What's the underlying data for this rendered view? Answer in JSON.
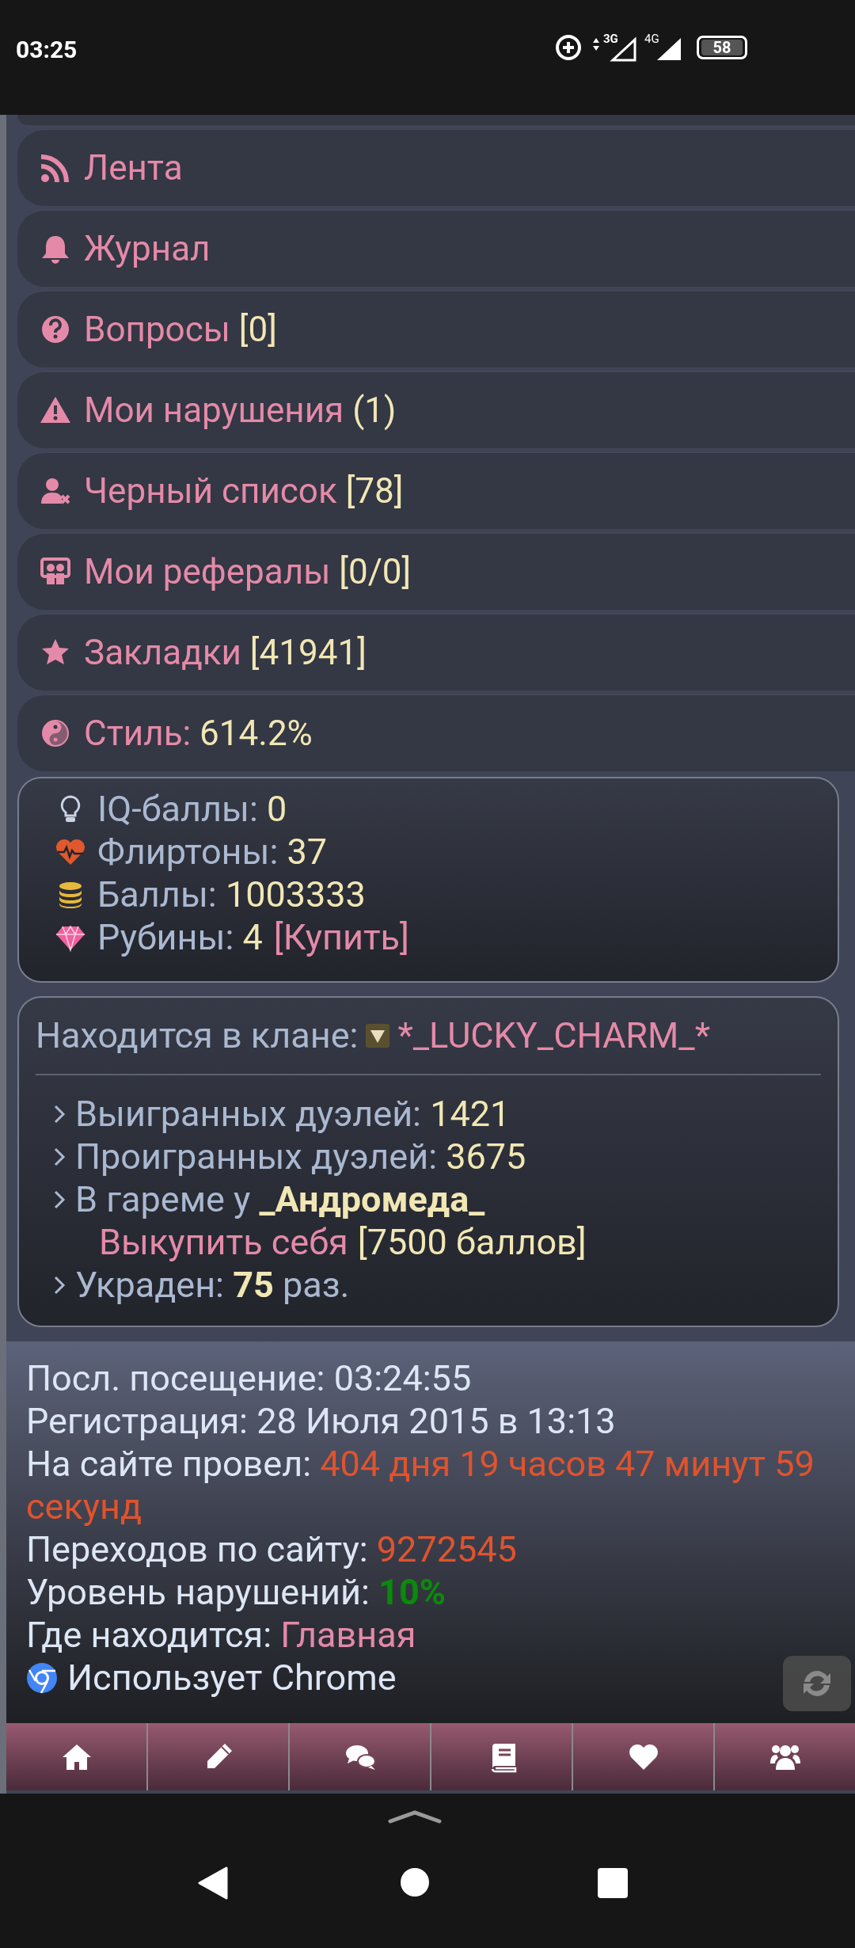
{
  "status_bar": {
    "time": "03:25",
    "network_1": "3G",
    "network_2": "4G",
    "battery": "58"
  },
  "menu": [
    {
      "label": "Лента"
    },
    {
      "label": "Журнал"
    },
    {
      "label": "Вопросы",
      "count": "[0]"
    },
    {
      "label": "Мои нарушения",
      "count": "(1)"
    },
    {
      "label": "Черный список",
      "count": "[78]"
    },
    {
      "label": "Мои рефералы",
      "count": "[0/0]"
    },
    {
      "label": "Закладки",
      "count": "[41941]"
    },
    {
      "label": "Стиль:",
      "count": "614.2%"
    }
  ],
  "wallet": [
    {
      "label": "IQ-баллы:",
      "value": "0"
    },
    {
      "label": "Флиртоны:",
      "value": "37"
    },
    {
      "label": "Баллы:",
      "value": "1003333"
    },
    {
      "label": "Рубины:",
      "value": "4",
      "link": "[Купить]"
    }
  ],
  "clan": {
    "label": "Находится в клане:",
    "name": "*_LUCKY_CHARM_*",
    "rows": [
      {
        "label": "Выигранных дуэлей:",
        "value": "1421"
      },
      {
        "label": "Проигранных дуэлей:",
        "value": "3675"
      },
      {
        "label": "В гареме у",
        "value": "_Андромеда_",
        "bold": true,
        "link": "Выкупить себя",
        "note": "[7500 баллов]"
      },
      {
        "label": "Украден:",
        "value": "75",
        "bold": true,
        "suffix": "раз."
      }
    ]
  },
  "info": [
    {
      "label": "Посл. посещение:",
      "value": "03:24:55"
    },
    {
      "label": "Регистрация:",
      "value": "28 Июля 2015 в 13:13"
    },
    {
      "label": "На сайте провел:",
      "value": "404 дня 19 часов 47 минут 59 секунд",
      "color": "#e0532d"
    },
    {
      "label": "Переходов по сайту:",
      "value": "9272545",
      "color": "#e0532d"
    },
    {
      "label": "Уровень нарушений:",
      "value": "10%",
      "color": "#0a8a0a",
      "bold": true
    },
    {
      "label": "Где находится:",
      "value": "Главная",
      "color": "#e489a8"
    },
    {
      "kind": "browser",
      "label": "Использует Chrome"
    }
  ]
}
